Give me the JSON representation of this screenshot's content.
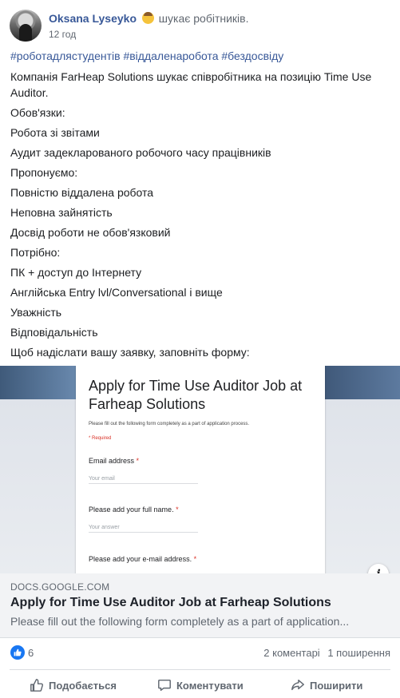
{
  "post": {
    "author": "Oksana Lyseyko",
    "action": "шукає робітників.",
    "time": "12 год",
    "hashtags": "#роботадлястудентів #віддаленаробота #бездосвіду",
    "lines": [
      "Компанія FarHeap Solutions шукає співробітника на позицію Time Use Auditor.",
      "Обов'язки:",
      "Робота зі звітами",
      "Аудит задекларованого робочого часу працівників",
      "Пропонуємо:",
      "Повністю віддалена робота",
      "Неповна зайнятість",
      "Досвід роботи не обов'язковий",
      "Потрібно:",
      "ПК + доступ до Інтернету",
      "Англійська Entry lvl/Conversational і вище",
      "Уважність",
      "Відповідальність",
      "Щоб надіслати вашу заявку, заповніть форму:"
    ]
  },
  "preview": {
    "form_title": "Apply for Time Use Auditor Job at Farheap Solutions",
    "form_description": "Please fill out the following form completely as a part of application process.",
    "required_note": "* Required",
    "questions": [
      {
        "label": "Email address",
        "star": "*",
        "placeholder": "Your email"
      },
      {
        "label": "Please add your full name.",
        "star": "*",
        "placeholder": "Your answer"
      },
      {
        "label": "Please add your e-mail address.",
        "star": "*"
      }
    ],
    "info_icon": "i"
  },
  "link": {
    "domain": "DOCS.GOOGLE.COM",
    "title": "Apply for Time Use Auditor Job at Farheap Solutions",
    "description": "Please fill out the following form completely as a part of application..."
  },
  "stats": {
    "like_count": "6",
    "comments": "2 коментарі",
    "shares": "1 поширення"
  },
  "actions": {
    "like": "Подобається",
    "comment": "Коментувати",
    "share": "Поширити"
  },
  "colors": {
    "link_blue": "#385898",
    "like_blue": "#1877f2",
    "required_red": "#d93025"
  }
}
